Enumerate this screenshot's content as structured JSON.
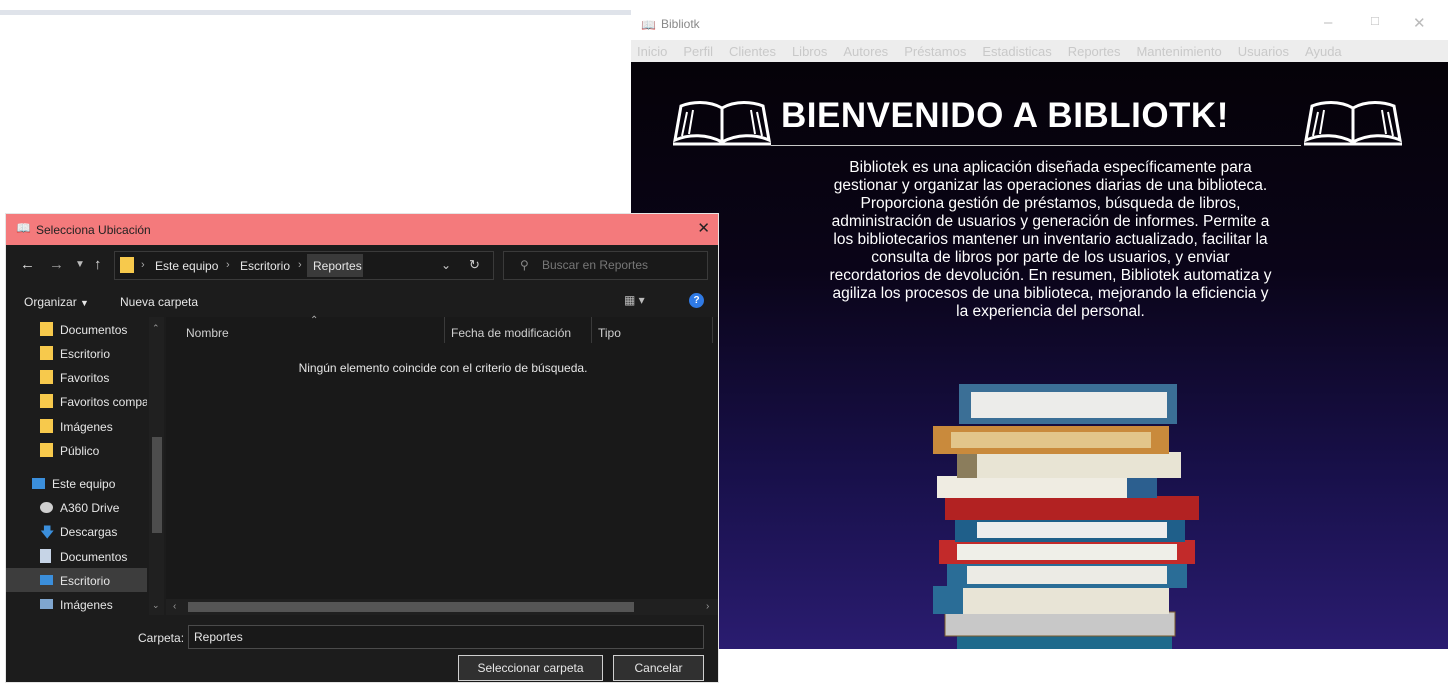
{
  "app": {
    "title": "Bibliotk",
    "menu": [
      "Inicio",
      "Perfil",
      "Clientes",
      "Libros",
      "Autores",
      "Préstamos",
      "Estadisticas",
      "Reportes",
      "Mantenimiento",
      "Usuarios",
      "Ayuda"
    ],
    "welcome_title": "BIENVENIDO A BIBLIOTK!",
    "description": "Bibliotek es una aplicación diseñada específicamente para gestionar y organizar las operaciones diarias de una biblioteca. Proporciona gestión de préstamos, búsqueda de libros, administración de usuarios y generación de informes. Permite a los bibliotecarios mantener un inventario actualizado, facilitar la consulta de libros por parte de los usuarios, y enviar recordatorios de devolución. En resumen, Bibliotek automatiza y agiliza los procesos de una biblioteca, mejorando la eficiencia y la experiencia del personal.",
    "colors": {
      "content_bg_top": "#050208",
      "content_bg_bottom": "#2a1c70"
    }
  },
  "dialog": {
    "title": "Selecciona Ubicación",
    "breadcrumb": [
      "Este equipo",
      "Escritorio",
      "Reportes"
    ],
    "search_placeholder": "Buscar en Reportes",
    "organize_label": "Organizar",
    "new_folder_label": "Nueva carpeta",
    "nav_items": [
      {
        "label": "Documentos",
        "icon": "folder-icon"
      },
      {
        "label": "Escritorio",
        "icon": "folder-icon"
      },
      {
        "label": "Favoritos",
        "icon": "folder-icon"
      },
      {
        "label": "Favoritos compa",
        "icon": "folder-icon"
      },
      {
        "label": "Imágenes",
        "icon": "folder-icon"
      },
      {
        "label": "Público",
        "icon": "folder-icon"
      },
      {
        "label": "Este equipo",
        "icon": "computer-icon"
      },
      {
        "label": "A360 Drive",
        "icon": "cloud-drive-icon"
      },
      {
        "label": "Descargas",
        "icon": "download-icon"
      },
      {
        "label": "Documentos",
        "icon": "document-icon"
      },
      {
        "label": "Escritorio",
        "icon": "desktop-icon"
      },
      {
        "label": "Imágenes",
        "icon": "pictures-icon"
      }
    ],
    "columns": [
      "Nombre",
      "Fecha de modificación",
      "Tipo"
    ],
    "empty_message": "Ningún elemento coincide con el criterio de búsqueda.",
    "folder_label": "Carpeta:",
    "folder_value": "Reportes",
    "select_button": "Seleccionar carpeta",
    "cancel_button": "Cancelar",
    "colors": {
      "titlebar": "#f47a7c",
      "folder": "#f7c94c",
      "help": "#2f7ae5"
    }
  }
}
